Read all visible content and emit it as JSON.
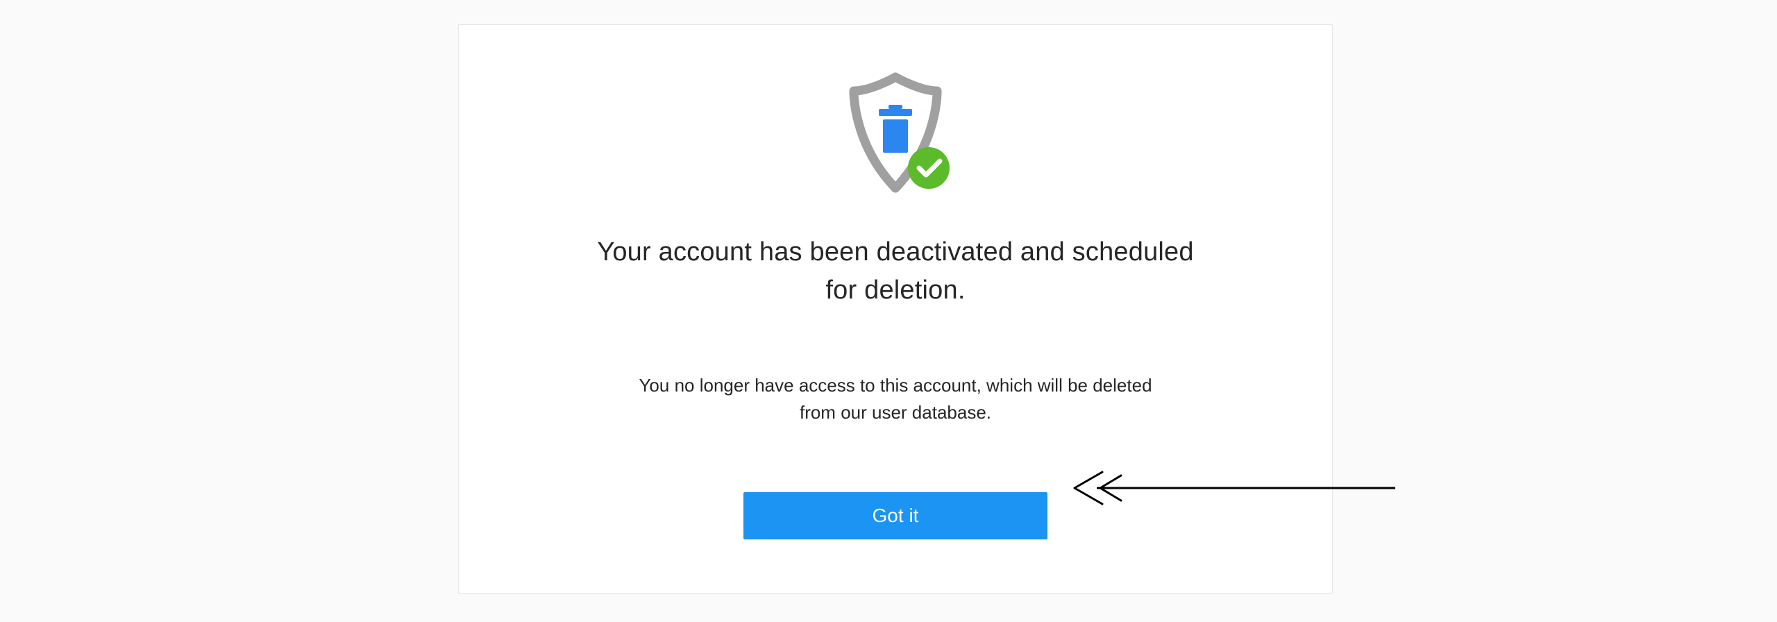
{
  "dialog": {
    "heading": "Your account has been deactivated and scheduled for deletion.",
    "subtext": "You no longer have access to this account, which will be deleted from our user database.",
    "primary_button_label": "Got it",
    "icons": {
      "shield": "shield-icon",
      "trash": "trash-icon",
      "check": "checkmark-icon"
    },
    "colors": {
      "button": "#1b94f4",
      "shield_stroke": "#a0a0a0",
      "trash_fill": "#2b87ef",
      "check_bg": "#5bbb2a",
      "check_mark": "#ffffff"
    }
  },
  "annotation": {
    "type": "arrow",
    "direction": "left",
    "target": "primary-button"
  }
}
